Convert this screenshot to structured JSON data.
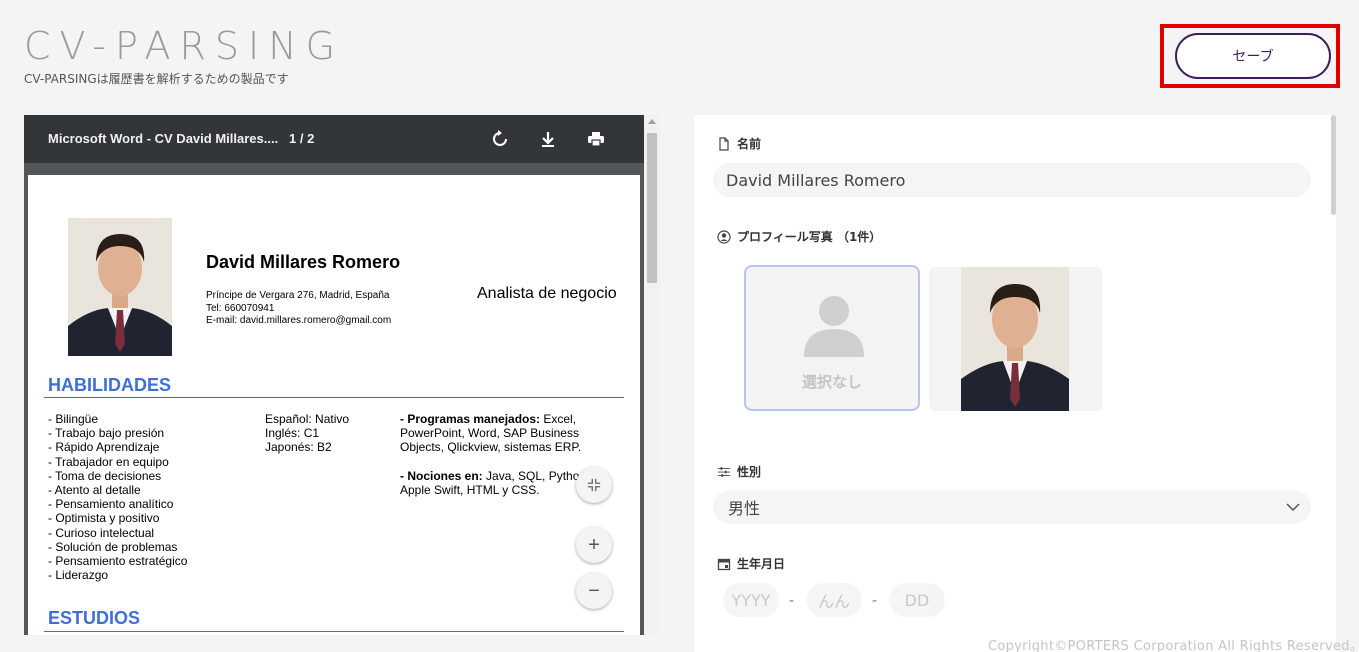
{
  "header": {
    "title": "CV-PARSING",
    "subtitle": "CV-PARSINGは履歴書を解析するための製品です",
    "save_label": "セーブ"
  },
  "pdf": {
    "title": "Microsoft Word - CV David Millares....",
    "pages": "1 / 2",
    "icons": [
      "rotate-icon",
      "download-icon",
      "print-icon"
    ],
    "cv": {
      "name": "David Millares Romero",
      "contact": [
        "Príncipe de Vergara 276, Madrid, España",
        "Tel: 660070941",
        "E-mail: david.millares.romero@gmail.com"
      ],
      "role": "Analista de negocio",
      "section_skills": "HABILIDADES",
      "skills": [
        "- Bilingüe",
        "- Trabajo bajo presión",
        "- Rápido Aprendizaje",
        "- Trabajador en equipo",
        "- Toma de decisiones",
        "- Atento al detalle",
        "- Pensamiento analítico",
        "- Optimista y positivo",
        "- Curioso intelectual",
        "- Solución de problemas",
        "- Pensamiento estratégico",
        "- Liderazgo"
      ],
      "languages": [
        "Español: Nativo",
        "Inglés: C1",
        "Japonés: B2"
      ],
      "programs_label": "- Programas manejados:",
      "programs_lines": [
        " Excel,",
        "PowerPoint, Word, SAP Business",
        "Objects, Qlickview, sistemas ERP."
      ],
      "notions_label": "- Nociones en:",
      "notions_lines": [
        " Java, SQL, Pytho",
        "Apple Swift, HTML y CSS."
      ],
      "section_studies": "ESTUDIOS"
    },
    "zoom": {
      "fit": "fit-icon",
      "in": "+",
      "out": "−"
    }
  },
  "form": {
    "name_label": "名前",
    "name_value": "David Millares Romero",
    "photo_label": "プロフィール写真 （1件）",
    "photo_none": "選択なし",
    "gender_label": "性別",
    "gender_value": "男性",
    "dob_label": "生年月日",
    "dob_year_placeholder": "YYYY",
    "dob_month_placeholder": "んん",
    "dob_day_placeholder": "DD",
    "dob_sep": "-"
  },
  "footer": {
    "copyright": "Copyright©PORTERS Corporation All Rights Reserved。"
  },
  "colors": {
    "accent": "#3b1f5e",
    "highlight": "#e00000",
    "cv_heading": "#3f6fd8"
  }
}
